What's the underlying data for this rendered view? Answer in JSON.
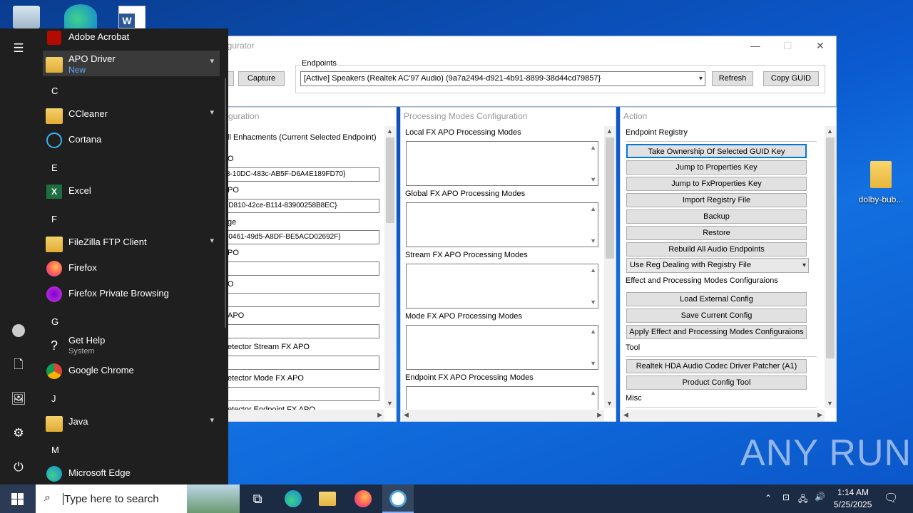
{
  "desktop": {
    "icons": [
      {
        "label": "dolby-bub..."
      }
    ]
  },
  "app": {
    "title": "igurator",
    "endpoints_label": "Endpoints",
    "capture_label": "Capture",
    "endpoint_value": "[Active] Speakers (Realtek AC'97 Audio) (9a7a2494-d921-4b91-8899-38d44cd79857}",
    "refresh_label": "Refresh",
    "copy_guid_label": "Copy GUID",
    "left_panel": {
      "title": "guration",
      "header": "ll Enhacments (Current Selected Endpoint)",
      "fields": [
        {
          "label": "O",
          "value": "3-10DC-483c-AB5F-D6A4E189FD70}"
        },
        {
          "label": "PO",
          "value": "-D810-42ce-B114-83900258B8EC}"
        },
        {
          "label": "ge",
          "value": "-0461-49d5-A8DF-BE5ACD02692F}"
        },
        {
          "label": "PO",
          "value": ""
        },
        {
          "label": "O",
          "value": ""
        },
        {
          "label": "APO",
          "value": ""
        },
        {
          "label": "etector Stream FX APO",
          "value": ""
        },
        {
          "label": "etector Mode FX APO",
          "value": ""
        },
        {
          "label": "etector Endpoint FX APO",
          "value": ""
        }
      ]
    },
    "middle_panel": {
      "title": "Processing Modes Configuration",
      "lists": [
        "Local FX APO Processing Modes",
        "Global FX APO Processing Modes",
        "Stream FX APO Processing Modes",
        "Mode FX APO Processing Modes",
        "Endpoint FX APO Processing Modes"
      ]
    },
    "right_panel": {
      "title": "Action",
      "sections": {
        "registry": "Endpoint Registry",
        "effects": "Effect and Processing Modes Configuraions",
        "tool": "Tool",
        "misc": "Misc"
      },
      "registry_buttons": [
        "Take Ownership Of Selected GUID Key",
        "Jump to Properties Key",
        "Jump to FxProperties Key",
        "Import Registry File",
        "Backup",
        "Restore",
        "Rebuild All Audio Endpoints"
      ],
      "registry_dropdown": "Use Reg Dealing with Registry File",
      "effects_buttons": [
        "Load External Config",
        "Save Current Config",
        "Apply Effect and Processing Modes Configuraions"
      ],
      "tool_buttons": [
        "Realtek HDA Audio Codec Driver Patcher (A1)",
        "Product Config Tool"
      ]
    }
  },
  "start_menu": {
    "letters": [
      "C",
      "E",
      "F",
      "G",
      "J",
      "M"
    ],
    "items": [
      {
        "name": "Adobe Acrobat"
      },
      {
        "name": "APO Driver",
        "sub": "New"
      },
      {
        "name": "CCleaner"
      },
      {
        "name": "Cortana"
      },
      {
        "name": "Excel"
      },
      {
        "name": "FileZilla FTP Client"
      },
      {
        "name": "Firefox"
      },
      {
        "name": "Firefox Private Browsing"
      },
      {
        "name": "Get Help",
        "sub": "System"
      },
      {
        "name": "Google Chrome"
      },
      {
        "name": "Java"
      },
      {
        "name": "Microsoft Edge"
      }
    ]
  },
  "taskbar": {
    "search_placeholder": "Type here to search",
    "time": "1:14 AM",
    "date": "5/25/2025"
  },
  "watermark": "ANY RUN",
  "colors": {
    "accent": "#0078d7",
    "start_bg": "#1f1f1f",
    "taskbar_bg": "#1b2b44"
  }
}
